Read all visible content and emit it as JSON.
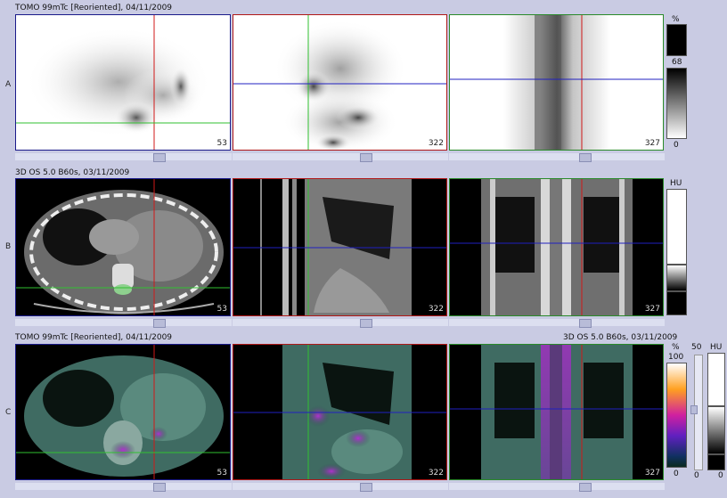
{
  "rows": {
    "a": {
      "label": "A",
      "header": "TOMO 99mTc [Reoriented], 04/11/2009",
      "slices": [
        "53",
        "322",
        "327"
      ]
    },
    "b": {
      "label": "B",
      "header": "3D  OS  5.0  B60s, 03/11/2009",
      "slices": [
        "53",
        "322",
        "327"
      ]
    },
    "c": {
      "label": "C",
      "header_left": "TOMO 99mTc [Reoriented], 04/11/2009",
      "header_right": "3D  OS  5.0  B60s, 03/11/2009",
      "slices": [
        "53",
        "322",
        "327"
      ]
    }
  },
  "scales": {
    "a": {
      "unit": "%",
      "max": "68",
      "min": "0"
    },
    "b": {
      "unit": "HU"
    },
    "c": {
      "unit": "%",
      "max": "100",
      "min": "0",
      "ct_unit": "HU",
      "ct_max": "50",
      "ct_min": "0",
      "ct_scale_label": "0"
    }
  },
  "colors": {
    "background": "#c9cbe3",
    "crosshair_red": "#d01818",
    "crosshair_green": "#30c030",
    "crosshair_blue": "#2020c0",
    "border_axial": "#1a1a8a",
    "border_coronal": "#b01818",
    "border_sagittal": "#2a8a2a"
  },
  "icons": [
    "slider-tab-icon"
  ]
}
